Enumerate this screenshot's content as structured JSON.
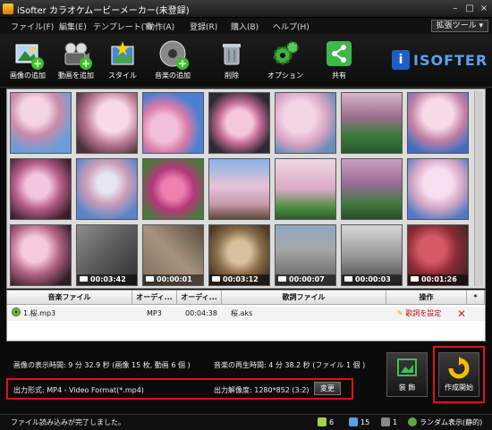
{
  "window": {
    "title": "iSofter カラオケムービーメーカー(未登録)",
    "controls": [
      "–",
      "□",
      "×"
    ]
  },
  "menu": {
    "items": [
      "ファイル(F)",
      "編集(E)",
      "テンプレート(T)",
      "動作(A)",
      "登録(R)",
      "購入(B)",
      "ヘルプ(H)"
    ],
    "ext_tools": "拡張ツール"
  },
  "toolbar": {
    "buttons": [
      {
        "label": "画像の追加",
        "icon": "add-image-icon"
      },
      {
        "label": "動画を追加",
        "icon": "add-video-icon"
      },
      {
        "label": "スタイル",
        "icon": "style-icon"
      },
      {
        "label": "音楽の追加",
        "icon": "add-music-icon"
      },
      {
        "label": "削除",
        "icon": "trash-icon"
      },
      {
        "label": "オプション",
        "icon": "gear-icon"
      },
      {
        "label": "共有",
        "icon": "share-icon"
      }
    ],
    "logo": {
      "badge": "i",
      "word": "ISOFTER"
    }
  },
  "media": {
    "videos": [
      {
        "duration": "00:03:42"
      },
      {
        "duration": "00:00:01"
      },
      {
        "duration": "00:03:12"
      },
      {
        "duration": "00:00:07"
      },
      {
        "duration": "00:00:03"
      },
      {
        "duration": "00:01:26"
      }
    ]
  },
  "music_table": {
    "headers": [
      "音楽ファイル",
      "オーディ...",
      "オーディ...",
      "歌詞ファイル",
      "操作",
      "*"
    ],
    "rows": [
      {
        "file": "1.桜.mp3",
        "format": "MP3",
        "duration": "00:04:38",
        "lyrics": "桜.aks",
        "action": "歌詞を設定",
        "delete": "✕"
      }
    ]
  },
  "info": {
    "image_time": "画像の表示時間: 9 分 32.9 秒 (画像 15 枚, 動画 6 個 )",
    "music_time": "音楽の再生時間: 4 分 38.2 秒 (ファイル 1 個 )",
    "output_format": "出力形式: MP4 - Video Format(*.mp4)",
    "output_resolution": "出力解像度: 1280*852 (3:2)",
    "change_label": "変更"
  },
  "actions": {
    "decorate_label": "装 飾",
    "create_label": "作成開始"
  },
  "status": {
    "message": "ファイル読み込みが完了しました。",
    "count_a": "6",
    "count_b": "15",
    "count_c": "1",
    "random_display": "ランダム表示(静的)"
  },
  "colors": {
    "highlight_red": "#e0101a",
    "sakura_pink": "#e8a0c0",
    "sky_blue": "#5a8fd8",
    "accent_green": "#3bbf2b"
  }
}
